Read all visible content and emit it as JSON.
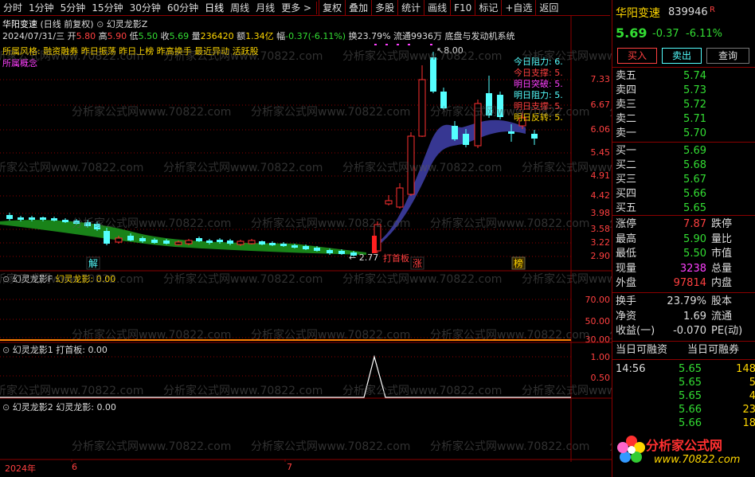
{
  "toolbar": {
    "items": [
      "分时",
      "1分钟",
      "5分钟",
      "15分钟",
      "30分钟",
      "60分钟",
      "日线",
      "周线",
      "月线",
      "更多 >",
      "复权",
      "叠加",
      "多股",
      "统计",
      "画线",
      "F10",
      "标记",
      "+自选",
      "返回"
    ]
  },
  "chart_header": {
    "title": "华阳变速",
    "mode": "(日线 前复权)",
    "indicator": "幻灵龙影Z"
  },
  "quote_line": {
    "date": "2024/07/31/三",
    "open_label": "开",
    "open": "5.80",
    "high_label": "高",
    "high": "5.90",
    "low_label": "低",
    "low": "5.50",
    "close_label": "收",
    "close": "5.69",
    "vol_label": "量",
    "vol": "236420",
    "amt_label": "额",
    "amt": "1.34亿",
    "chg_label": "幅",
    "chg": "-0.37(-6.11%)",
    "turn_label": "换",
    "turn": "23.79%",
    "float_label": "流通",
    "float": "9936万",
    "system": "底盘与发动机系统"
  },
  "tags_line": "所属风格: 融资融券  昨日振荡  昨日上榜  昨高换手  最近异动  活跃股",
  "concept_label": "所属概念",
  "legend": [
    {
      "label": "今日阻力:",
      "value": "6.",
      "color": "#5ff"
    },
    {
      "label": "今日支撑:",
      "value": "5.",
      "color": "#ff4040"
    },
    {
      "label": "明日突破:",
      "value": "5.",
      "color": "#ff40ff"
    },
    {
      "label": "明日阻力:",
      "value": "5.",
      "color": "#5ff"
    },
    {
      "label": "明日支撑:",
      "value": "5.",
      "color": "#ff4040"
    },
    {
      "label": "明日反转:",
      "value": "5.",
      "color": "#ffd700"
    }
  ],
  "annotations": {
    "peak": "8.00",
    "low": "2.77",
    "dashoubanlabel": "打首板",
    "jie": "解",
    "zhang": "涨",
    "bang": "榜"
  },
  "price_axis": [
    "7.33",
    "6.67",
    "6.06",
    "5.45",
    "4.91",
    "4.42",
    "3.98",
    "3.58",
    "3.22",
    "2.90"
  ],
  "date_axis": [
    "2024年",
    "6",
    "7"
  ],
  "sub1": {
    "name": "幻灵龙影F",
    "label": "幻灵龙影:",
    "value": "0.00",
    "axis": [
      "70.00",
      "50.00",
      "30.00"
    ]
  },
  "sub2": {
    "name": "幻灵龙影1",
    "label": "打首板:",
    "value": "0.00",
    "axis": [
      "1.00",
      "0.50"
    ]
  },
  "sub3": {
    "name": "幻灵龙影2",
    "label": "幻灵龙影:",
    "value": "0.00"
  },
  "watermark": "分析家公式网www.70822.com",
  "right_panel": {
    "name": "华阳变速",
    "code": "839946",
    "badge": "R",
    "price": "5.69",
    "change": "-0.37",
    "pct": "-6.11%",
    "buttons": [
      "买入",
      "卖出",
      "查询"
    ],
    "sell": [
      {
        "label": "卖五",
        "price": "5.74"
      },
      {
        "label": "卖四",
        "price": "5.73"
      },
      {
        "label": "卖三",
        "price": "5.72"
      },
      {
        "label": "卖二",
        "price": "5.71"
      },
      {
        "label": "卖一",
        "price": "5.70"
      }
    ],
    "buy": [
      {
        "label": "买一",
        "price": "5.69"
      },
      {
        "label": "买二",
        "price": "5.68"
      },
      {
        "label": "买三",
        "price": "5.67"
      },
      {
        "label": "买四",
        "price": "5.66"
      },
      {
        "label": "买五",
        "price": "5.65"
      }
    ],
    "stats1": [
      {
        "l1": "涨停",
        "v1": "7.87",
        "c1": "#ff4040",
        "l2": "跌停"
      },
      {
        "l1": "最高",
        "v1": "5.90",
        "c1": "#33dd33",
        "l2": "量比"
      },
      {
        "l1": "最低",
        "v1": "5.50",
        "c1": "#33dd33",
        "l2": "市值"
      },
      {
        "l1": "现量",
        "v1": "3238",
        "c1": "#ff40ff",
        "l2": "总量"
      },
      {
        "l1": "外盘",
        "v1": "97814",
        "c1": "#ff4040",
        "l2": "内盘"
      }
    ],
    "stats2": [
      {
        "l1": "换手",
        "v1": "23.79%",
        "c1": "#ddd",
        "l2": "股本"
      },
      {
        "l1": "净资",
        "v1": "1.69",
        "c1": "#ddd",
        "l2": "流通"
      },
      {
        "l1": "收益(一)",
        "v1": "-0.070",
        "c1": "#ddd",
        "l2": "PE(动)"
      }
    ],
    "margin_header": [
      "当日可融资",
      "当日可融券"
    ],
    "ticks": [
      {
        "time": "14:56",
        "price": "5.65",
        "vol": "148"
      },
      {
        "time": "",
        "price": "5.65",
        "vol": "5"
      },
      {
        "time": "",
        "price": "5.65",
        "vol": "4"
      },
      {
        "time": "",
        "price": "5.66",
        "vol": "23"
      },
      {
        "time": "",
        "price": "5.66",
        "vol": "18"
      }
    ],
    "logo_cn": "分析家公式网",
    "logo_url": "www.70822.com"
  },
  "colors": {
    "up": "#ff3030",
    "down": "#54ffff",
    "grid": "#8b0000",
    "ribbon_green": "#1a8a1a",
    "ribbon_blue": "#4444aa"
  }
}
